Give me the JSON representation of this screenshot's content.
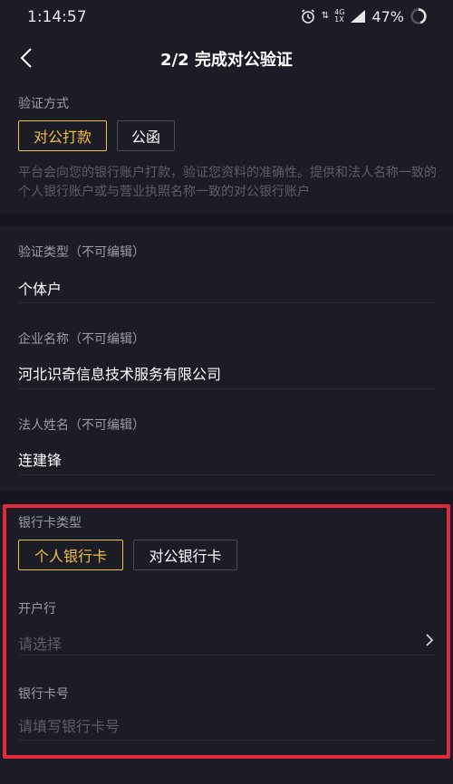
{
  "status": {
    "time": "1:14:57",
    "network": "4G",
    "network_sub": "1X",
    "battery": "47%"
  },
  "nav": {
    "title": "2/2 完成对公验证"
  },
  "verify_method": {
    "label": "验证方式",
    "options": [
      "对公打款",
      "公函"
    ],
    "selected": "对公打款",
    "hint": "平台会向您的银行账户打款，验证您资料的准确性。提供和法人名称一致的个人银行账户或与营业执照名称一致的对公银行账户"
  },
  "info": {
    "type_label": "验证类型（不可编辑）",
    "type_value": "个体户",
    "company_label": "企业名称（不可编辑）",
    "company_value": "河北识奇信息技术服务有限公司",
    "legal_label": "法人姓名（不可编辑）",
    "legal_value": "连建锋"
  },
  "bank": {
    "type_label": "银行卡类型",
    "options": [
      "个人银行卡",
      "对公银行卡"
    ],
    "selected": "个人银行卡",
    "branch_label": "开户行",
    "branch_placeholder": "请选择",
    "card_label": "银行卡号",
    "card_placeholder": "请填写银行卡号"
  },
  "colors": {
    "accent": "#f0c040",
    "highlight": "#e12a3a",
    "background": "#14151d",
    "panel": "#1b1c25"
  }
}
